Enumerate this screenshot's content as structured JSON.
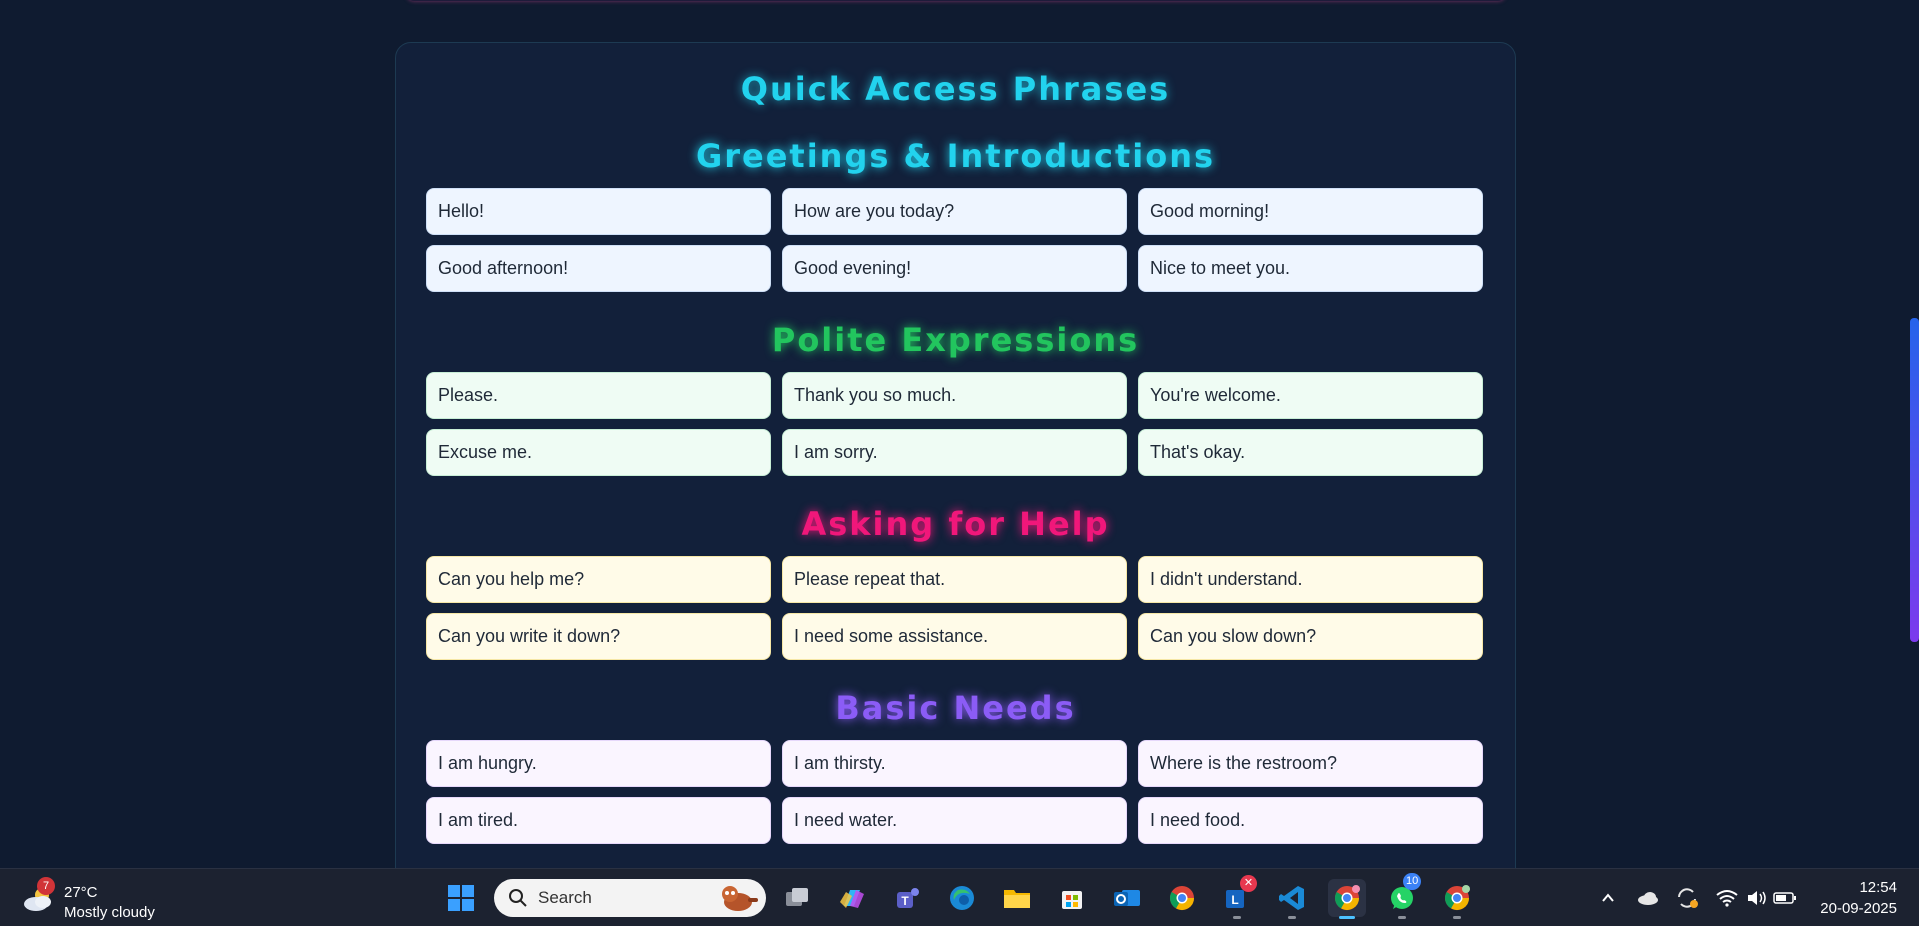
{
  "page_title": "Quick Access Phrases",
  "colors": {
    "background": "#0f1b30",
    "panel": "#12203a",
    "title_cyan": "#22d3ee",
    "scroll_thumb_top": "#2563eb",
    "scroll_thumb_bottom": "#7c3aed"
  },
  "sections": [
    {
      "title": "Greetings & Introductions",
      "title_color": "#22d3ee",
      "card_color": "#eef5ff",
      "card_border": "#cfe0f7",
      "phrases": [
        "Hello!",
        "How are you today?",
        "Good morning!",
        "Good afternoon!",
        "Good evening!",
        "Nice to meet you."
      ]
    },
    {
      "title": "Polite Expressions",
      "title_color": "#22c55e",
      "card_color": "#effcf4",
      "card_border": "#c8eed6",
      "phrases": [
        "Please.",
        "Thank you so much.",
        "You're welcome.",
        "Excuse me.",
        "I am sorry.",
        "That's okay."
      ]
    },
    {
      "title": "Asking for Help",
      "title_color": "#f0177a",
      "card_color": "#fffbe8",
      "card_border": "#f6e7a6",
      "phrases": [
        "Can you help me?",
        "Please repeat that.",
        "I didn't understand.",
        "Can you write it down?",
        "I need some assistance.",
        "Can you slow down?"
      ]
    },
    {
      "title": "Basic Needs",
      "title_color": "#8b5cf6",
      "card_color": "#faf5ff",
      "card_border": "#e6d8fb",
      "phrases": [
        "I am hungry.",
        "I am thirsty.",
        "Where is the restroom?",
        "I am tired.",
        "I need water.",
        "I need food."
      ]
    }
  ],
  "taskbar": {
    "weather": {
      "temp": "27°C",
      "desc": "Mostly cloudy",
      "badge": "7"
    },
    "search": {
      "label": "Search"
    },
    "apps": [
      {
        "name": "start-icon"
      },
      {
        "name": "task-view-icon"
      },
      {
        "name": "copilot-icon"
      },
      {
        "name": "teams-icon"
      },
      {
        "name": "edge-icon"
      },
      {
        "name": "file-explorer-icon"
      },
      {
        "name": "microsoft-store-icon"
      },
      {
        "name": "outlook-icon"
      },
      {
        "name": "chrome-icon"
      },
      {
        "name": "lync-icon"
      },
      {
        "name": "vscode-icon"
      },
      {
        "name": "chrome-profile-icon"
      },
      {
        "name": "whatsapp-icon"
      },
      {
        "name": "chrome-dev-icon"
      }
    ],
    "whatsapp_badge": "10",
    "clock": {
      "time": "12:54",
      "date": "20-09-2025"
    }
  }
}
